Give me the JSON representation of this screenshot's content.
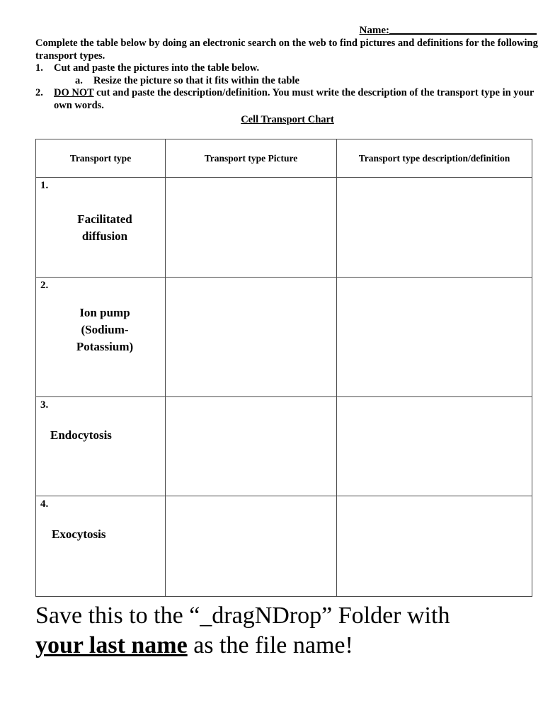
{
  "document": {
    "name_field": {
      "label": "Name:",
      "value": ""
    },
    "intro": "Complete the table below by doing an electronic search on the web to find pictures and definitions for the following transport types.",
    "instructions": [
      {
        "marker": "1.",
        "text": "Cut and paste the pictures into the table below.",
        "sub": [
          {
            "marker": "a.",
            "text": "Resize the picture so that it fits within the table"
          }
        ]
      },
      {
        "marker": "2.",
        "emphasis": "DO NOT",
        "text": " cut and paste the description/definition.  You must write the description of the transport type in your own words."
      }
    ],
    "chart_title": "Cell Transport Chart",
    "table": {
      "headers": [
        "Transport type",
        "Transport type Picture",
        "Transport type description/definition"
      ],
      "rows": [
        {
          "number": "1.",
          "type": "Facilitated\ndiffusion",
          "picture": "",
          "description": ""
        },
        {
          "number": "2.",
          "type": "Ion pump\n(Sodium-\nPotassium)",
          "picture": "",
          "description": ""
        },
        {
          "number": "3.",
          "type": "Endocytosis",
          "picture": "",
          "description": ""
        },
        {
          "number": "4.",
          "type": "Exocytosis",
          "picture": "",
          "description": ""
        }
      ]
    },
    "footer": {
      "line1": "Save this to the “_dragNDrop” Folder with",
      "line2_bold": "your last name",
      "line2_rest": " as the file name!"
    }
  }
}
